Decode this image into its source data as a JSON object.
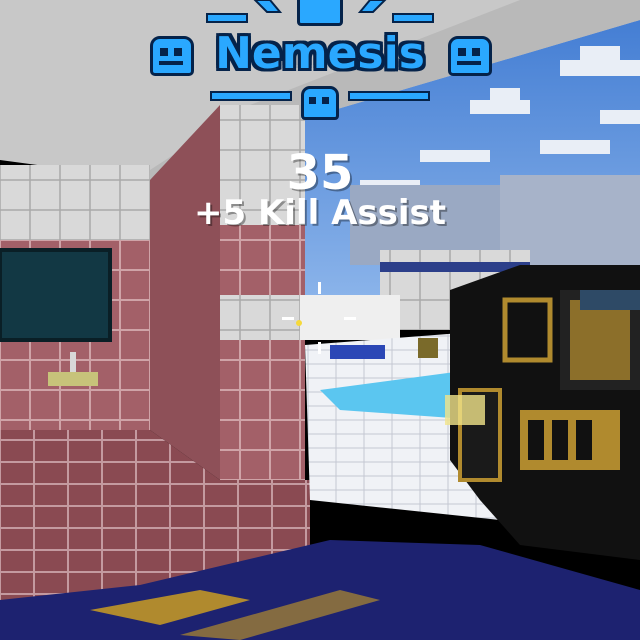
{
  "hud": {
    "streak_title": "Nemesis",
    "points": "35",
    "event_message": "+5 Kill Assist"
  },
  "icons": {
    "banner_skull": "skull-icon",
    "crosshair": "crosshair-icon"
  },
  "colors": {
    "title_blue": "#2aa8ff",
    "title_outline": "#05234a",
    "sky": "#4e86d8",
    "tile_red": "#a6646c",
    "gun_gold": "#b08a2e"
  }
}
